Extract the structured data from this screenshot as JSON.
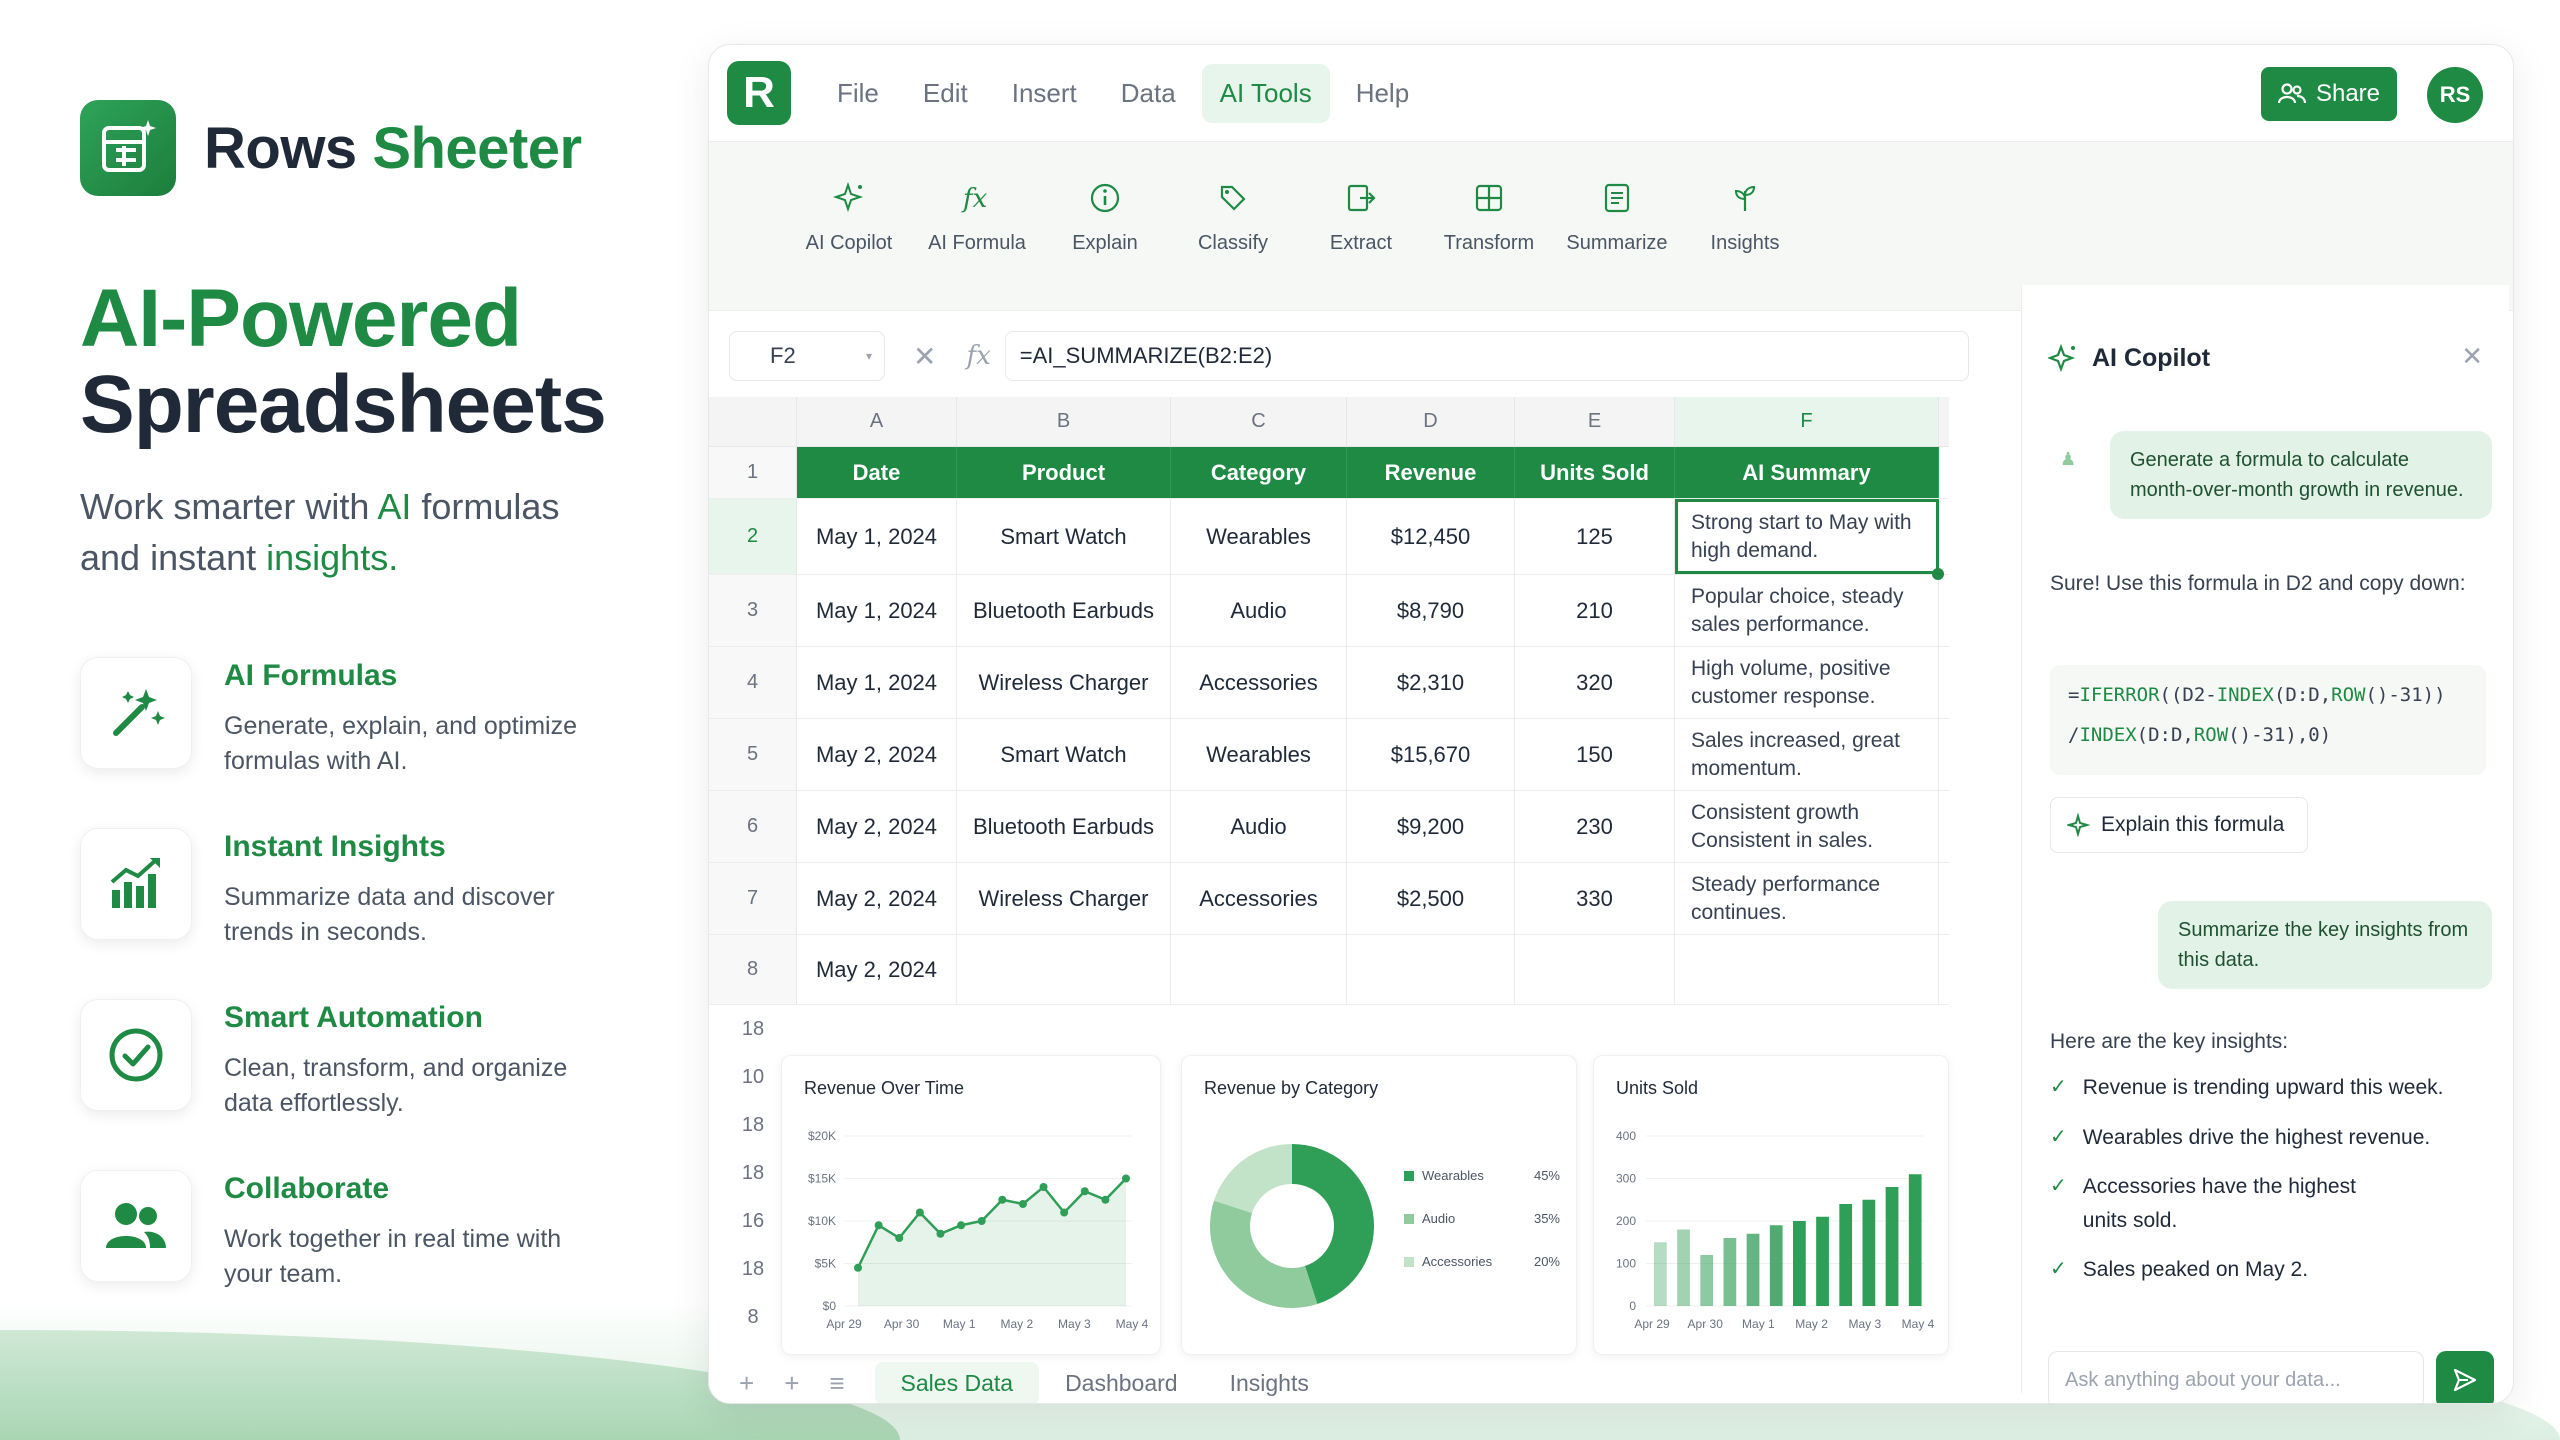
{
  "brand": {
    "name_part1": "Rows",
    "name_part2": "Sheeter"
  },
  "hero": {
    "headline_line1": "AI-Powered",
    "headline_line2": "Spreadsheets",
    "sub_a": "Work smarter with ",
    "sub_ai": "AI",
    "sub_b": " formulas",
    "sub_c": "and instant ",
    "sub_insights": "insights."
  },
  "features": [
    {
      "title": "AI Formulas",
      "desc": "Generate, explain, and optimize formulas with AI.",
      "icon": "magic-wand-icon"
    },
    {
      "title": "Instant Insights",
      "desc": "Summarize data and discover trends in seconds.",
      "icon": "chart-icon"
    },
    {
      "title": "Smart Automation",
      "desc": "Clean, transform, and organize data effortlessly.",
      "icon": "check-circle-icon"
    },
    {
      "title": "Collaborate",
      "desc": "Work together in real time with your team.",
      "icon": "users-icon"
    }
  ],
  "app": {
    "logo_letter": "R",
    "menus": [
      "File",
      "Edit",
      "Insert",
      "Data",
      "AI Tools",
      "Help"
    ],
    "active_menu": "AI Tools",
    "share_label": "Share",
    "avatar_initials": "RS",
    "tools": [
      "AI Copilot",
      "AI Formula",
      "Explain",
      "Classify",
      "Extract",
      "Transform",
      "Summarize",
      "Insights"
    ],
    "cell_ref": "F2",
    "formula": "=AI_SUMMARIZE(B2:E2)"
  },
  "grid": {
    "columns": [
      "A",
      "B",
      "C",
      "D",
      "E",
      "F"
    ],
    "headers": [
      "Date",
      "Product",
      "Category",
      "Revenue",
      "Units Sold",
      "AI Summary"
    ],
    "row_numbers": [
      "1",
      "2",
      "3",
      "4",
      "5",
      "6",
      "7",
      "8"
    ],
    "rows": [
      [
        "May 1, 2024",
        "Smart Watch",
        "Wearables",
        "$12,450",
        "125",
        "Strong start to May with high demand."
      ],
      [
        "May 1, 2024",
        "Bluetooth Earbuds",
        "Audio",
        "$8,790",
        "210",
        "Popular choice, steady sales performance."
      ],
      [
        "May 1, 2024",
        "Wireless Charger",
        "Accessories",
        "$2,310",
        "320",
        "High volume, positive customer response."
      ],
      [
        "May 2, 2024",
        "Smart Watch",
        "Wearables",
        "$15,670",
        "150",
        "Sales increased, great momentum."
      ],
      [
        "May 2, 2024",
        "Bluetooth Earbuds",
        "Audio",
        "$9,200",
        "230",
        "Consistent growth Consistent in sales."
      ],
      [
        "May 2, 2024",
        "Wireless Charger",
        "Accessories",
        "$2,500",
        "330",
        "Steady performance continues."
      ],
      [
        "May 2, 2024",
        "",
        "",
        "",
        "",
        ""
      ]
    ],
    "lower_row_numbers": [
      "18",
      "10",
      "18",
      "18",
      "16",
      "18",
      "8"
    ]
  },
  "chart_data": [
    {
      "type": "area",
      "title": "Revenue Over Time",
      "x": [
        "Apr 29",
        "Apr 30",
        "May 1",
        "May 2",
        "May 3",
        "May 4"
      ],
      "y_ticks": [
        "$20K",
        "$15K",
        "$10K",
        "$5K",
        "$0"
      ],
      "ylim": [
        0,
        20000
      ],
      "series": [
        {
          "values": [
            4500,
            9500,
            8000,
            11000,
            8500,
            9500,
            10000,
            12500,
            12000,
            14000,
            11000,
            13500,
            12500,
            15000
          ]
        }
      ],
      "color": "#2f9e57"
    },
    {
      "type": "pie",
      "title": "Revenue by Category",
      "labels": [
        "Wearables",
        "Audio",
        "Accessories"
      ],
      "values": [
        45,
        35,
        20
      ],
      "value_labels": [
        "45%",
        "35%",
        "20%"
      ],
      "colors": [
        "#2f9e57",
        "#8fcb9d",
        "#c3e3c9"
      ]
    },
    {
      "type": "bar",
      "title": "Units Sold",
      "x": [
        "Apr 29",
        "Apr 30",
        "May 1",
        "May 2",
        "May 3",
        "May 4"
      ],
      "y_ticks": [
        "400",
        "300",
        "200",
        "100",
        "0"
      ],
      "ylim": [
        0,
        400
      ],
      "values": [
        150,
        180,
        120,
        160,
        170,
        190,
        200,
        210,
        240,
        250,
        280,
        310
      ],
      "color": "#2f9e57"
    }
  ],
  "sheet_tabs": [
    "Sales Data",
    "Dashboard",
    "Insights"
  ],
  "copilot": {
    "title": "AI Copilot",
    "user_msg_1": "Generate a formula to calculate month-over-month growth in revenue.",
    "assistant_1": "Sure! Use this formula in D2 and copy down:",
    "code_line1": "=IFERROR((D2-INDEX(D:D,ROW()-31))",
    "code_line2": "/INDEX(D:D,ROW()-31),0)",
    "explain_label": "Explain this formula",
    "user_msg_2": "Summarize the key insights from this data.",
    "assistant_2": "Here are the key insights:",
    "insights": [
      "Revenue is trending upward this week.",
      "Wearables drive the highest revenue.",
      "Accessories have the highest units sold.",
      "Sales peaked on May 2."
    ],
    "input_placeholder": "Ask anything about your data..."
  }
}
